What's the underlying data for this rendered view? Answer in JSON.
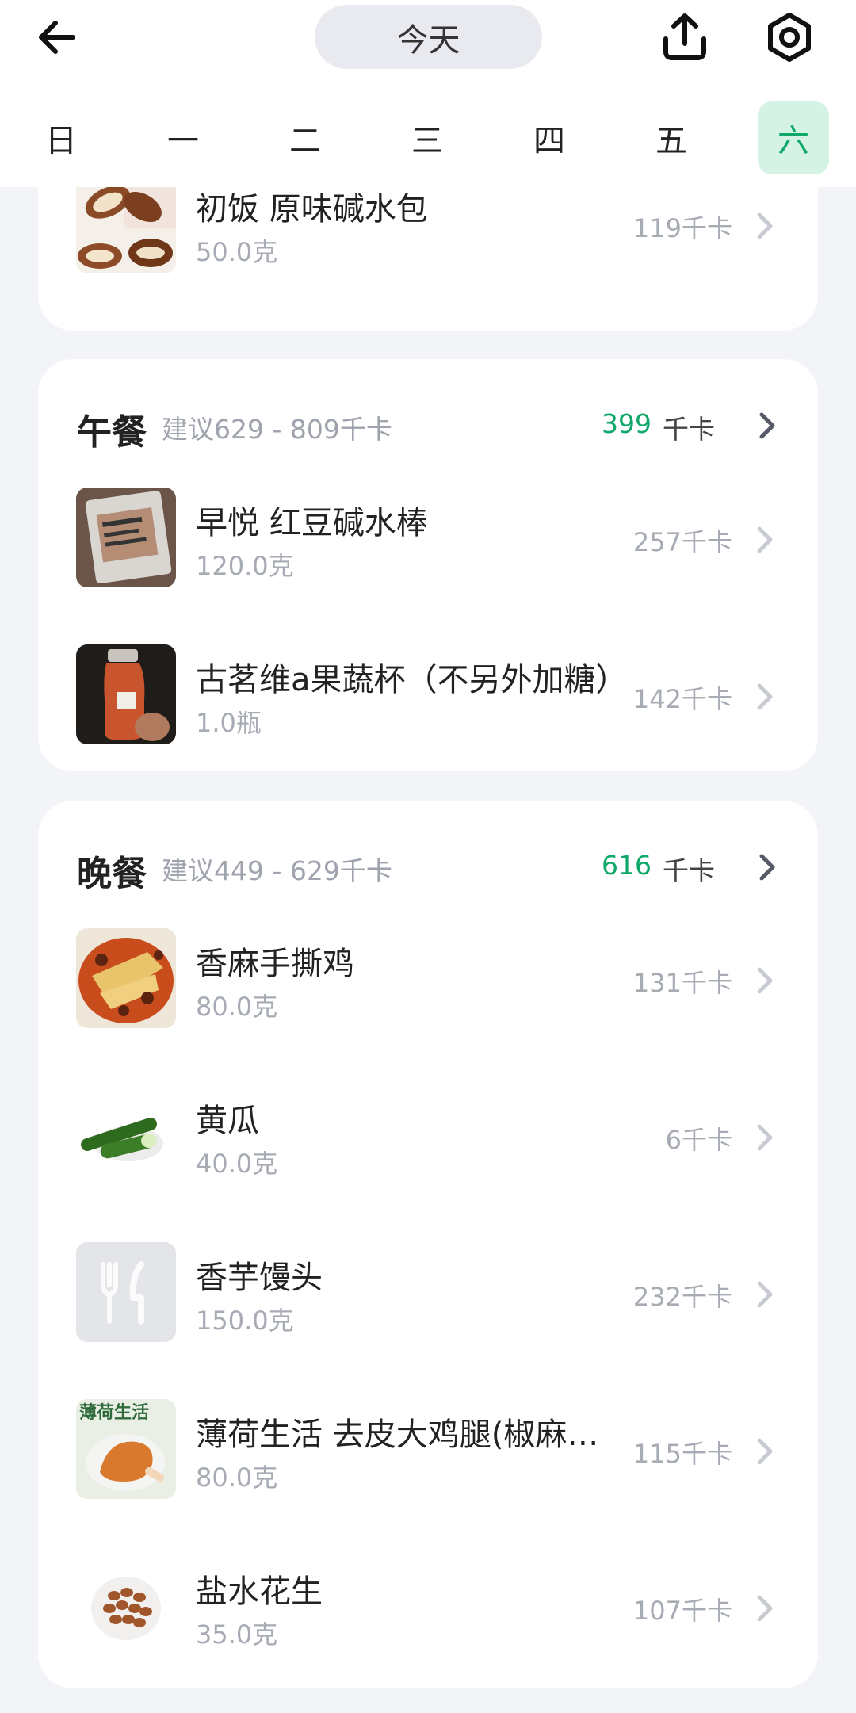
{
  "header": {
    "date_label": "今天",
    "back_icon": "arrow-left-icon",
    "share_icon": "share-upload-icon",
    "settings_icon": "settings-hex-icon"
  },
  "weekdays": [
    "日",
    "一",
    "二",
    "三",
    "四",
    "五",
    "六"
  ],
  "active_weekday": "六",
  "colors": {
    "accent": "#0fa86a",
    "active_bg": "#d5f3e5",
    "background": "#f3f4f8"
  },
  "breakfast_partial": {
    "items": [
      {
        "name": "初饭 原味碱水包",
        "qty": "50.0克",
        "kcal": "119千卡",
        "thumb": "pretzel-bread-photo"
      }
    ]
  },
  "lunch": {
    "name": "午餐",
    "suggest": "建议629 - 809千卡",
    "total": "399",
    "unit": "千卡",
    "items": [
      {
        "name": "早悦 红豆碱水棒",
        "qty": "120.0克",
        "kcal": "257千卡",
        "thumb": "packaged-bread-photo"
      },
      {
        "name": "古茗维a果蔬杯（不另外加糖）",
        "qty": "1.0瓶",
        "kcal": "142千卡",
        "thumb": "juice-bottle-photo"
      }
    ]
  },
  "dinner": {
    "name": "晚餐",
    "suggest": "建议449 - 629千卡",
    "total": "616",
    "unit": "千卡",
    "items": [
      {
        "name": "香麻手撕鸡",
        "qty": "80.0克",
        "kcal": "131千卡",
        "thumb": "shredded-chicken-photo"
      },
      {
        "name": "黄瓜",
        "qty": "40.0克",
        "kcal": "6千卡",
        "thumb": "cucumber-photo"
      },
      {
        "name": "香芋馒头",
        "qty": "150.0克",
        "kcal": "232千卡",
        "thumb": "fork-knife-placeholder"
      },
      {
        "name": "薄荷生活 去皮大鸡腿(椒麻…",
        "qty": "80.0克",
        "kcal": "115千卡",
        "thumb": "chicken-leg-package-photo"
      },
      {
        "name": "盐水花生",
        "qty": "35.0克",
        "kcal": "107千卡",
        "thumb": "peanuts-photo"
      }
    ]
  },
  "thumb_brand_text": "薄荷生活"
}
